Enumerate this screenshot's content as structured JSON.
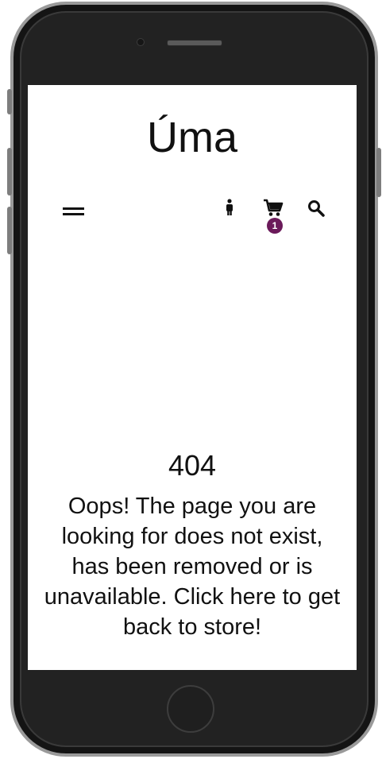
{
  "app": {
    "logo": "Úma"
  },
  "header": {
    "menu_icon": "hamburger-menu-icon",
    "icons": [
      "person-icon",
      "shopping-cart-icon",
      "search-icon"
    ],
    "cart_count": "1",
    "accent_color": "#6b1a5a"
  },
  "error": {
    "code": "404",
    "message": "Oops! The page you are looking for does not exist, has been removed or is unavailable. Click here to get back to store!"
  }
}
